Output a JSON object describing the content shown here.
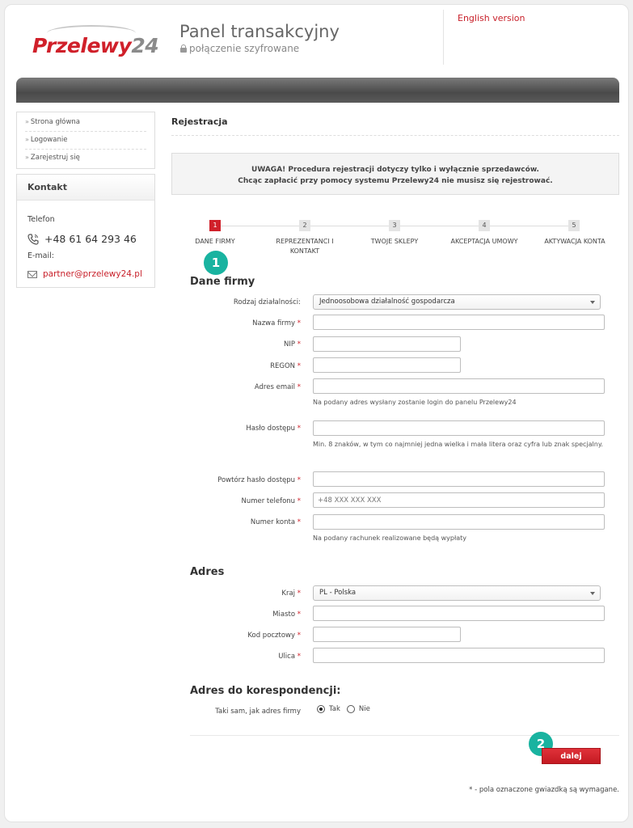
{
  "header": {
    "logo_main": "Przelewy",
    "logo_num": "24",
    "title": "Panel transakcyjny",
    "subtitle": "połączenie szyfrowane",
    "english_link": "English version"
  },
  "sidebar": {
    "nav": [
      {
        "label": "Strona główna"
      },
      {
        "label": "Logowanie"
      },
      {
        "label": "Zarejestruj się"
      }
    ],
    "contact": {
      "heading": "Kontakt",
      "phone_label": "Telefon",
      "phone": "+48 61 64 293 46",
      "email_label": "E-mail:",
      "email": "partner@przelewy24.pl"
    }
  },
  "main": {
    "title": "Rejestracja",
    "notice_line1": "UWAGA! Procedura rejestracji dotyczy tylko i wyłącznie sprzedawców.",
    "notice_line2": "Chcąc zapłacić przy pomocy systemu Przelewy24 nie musisz się rejestrować.",
    "steps": [
      {
        "num": "1",
        "label": "DANE FIRMY",
        "active": true
      },
      {
        "num": "2",
        "label": "REPREZENTANCI I KONTAKT"
      },
      {
        "num": "3",
        "label": "TWOJE SKLEPY"
      },
      {
        "num": "4",
        "label": "AKCEPTACJA UMOWY"
      },
      {
        "num": "5",
        "label": "AKTYWACJA KONTA"
      }
    ],
    "badges": [
      "1",
      "2"
    ],
    "company": {
      "title": "Dane firmy",
      "activity_label": "Rodzaj działalności:",
      "activity_value": "Jednoosobowa działalność gospodarcza",
      "name_label": "Nazwa firmy",
      "nip_label": "NIP",
      "regon_label": "REGON",
      "email_label": "Adres email",
      "email_hint": "Na podany adres wysłany zostanie login do panelu Przelewy24",
      "password_label": "Hasło dostępu",
      "password_hint": "Min. 8 znaków, w tym co najmniej jedna wielka i mała litera oraz cyfra lub znak specjalny.",
      "password2_label": "Powtórz hasło dostępu",
      "phone_label": "Numer telefonu",
      "phone_placeholder": "+48 XXX XXX XXX",
      "account_label": "Numer konta",
      "account_hint": "Na podany rachunek realizowane będą wypłaty"
    },
    "address": {
      "title": "Adres",
      "country_label": "Kraj",
      "country_value": "PL - Polska",
      "city_label": "Miasto",
      "zip_label": "Kod pocztowy",
      "street_label": "Ulica"
    },
    "correspondence": {
      "title": "Adres do korespondencji:",
      "same_label": "Taki sam, jak adres firmy",
      "yes": "Tak",
      "no": "Nie",
      "selected": "Tak"
    },
    "next_button": "dalej",
    "required_note": "* - pola oznaczone gwiazdką są wymagane.",
    "required_mark": "*"
  },
  "colors": {
    "brand_red": "#d0202a",
    "badge_teal": "#19b3a0"
  }
}
